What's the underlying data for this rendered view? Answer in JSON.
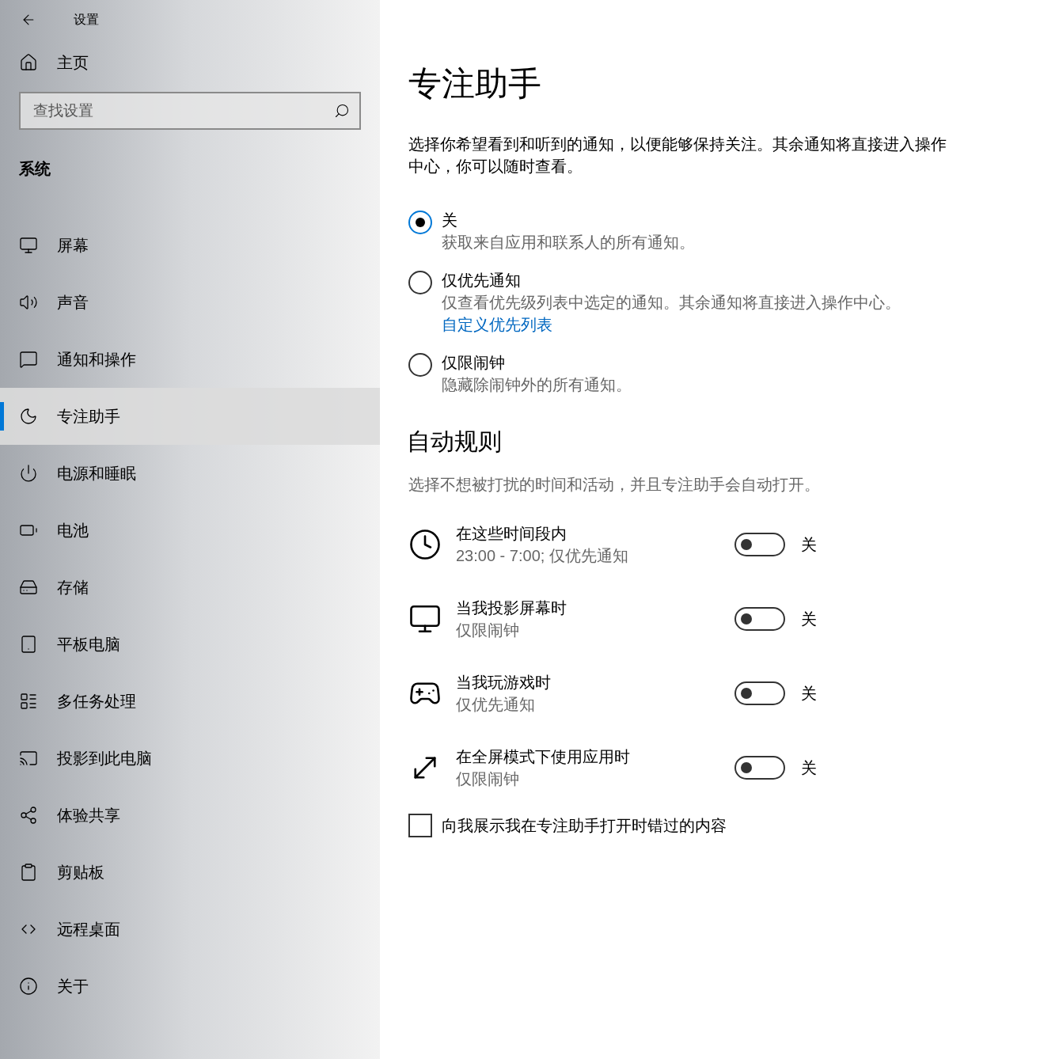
{
  "window": {
    "title": "设置"
  },
  "sidebar": {
    "home": "主页",
    "search": {
      "placeholder": "查找设置"
    },
    "section": "系统",
    "items": [
      {
        "label": "屏幕",
        "kind": "monitor",
        "selected": false
      },
      {
        "label": "声音",
        "kind": "speaker",
        "selected": false
      },
      {
        "label": "通知和操作",
        "kind": "message",
        "selected": false
      },
      {
        "label": "专注助手",
        "kind": "moon",
        "selected": true
      },
      {
        "label": "电源和睡眠",
        "kind": "power",
        "selected": false
      },
      {
        "label": "电池",
        "kind": "battery",
        "selected": false
      },
      {
        "label": "存储",
        "kind": "drive",
        "selected": false
      },
      {
        "label": "平板电脑",
        "kind": "tablet",
        "selected": false
      },
      {
        "label": "多任务处理",
        "kind": "multitask",
        "selected": false
      },
      {
        "label": "投影到此电脑",
        "kind": "project",
        "selected": false
      },
      {
        "label": "体验共享",
        "kind": "share",
        "selected": false
      },
      {
        "label": "剪贴板",
        "kind": "clipboard",
        "selected": false
      },
      {
        "label": "远程桌面",
        "kind": "remote",
        "selected": false
      },
      {
        "label": "关于",
        "kind": "info",
        "selected": false
      }
    ]
  },
  "main": {
    "title": "专注助手",
    "description": "选择你希望看到和听到的通知，以便能够保持关注。其余通知将直接进入操作中心，你可以随时查看。",
    "options": [
      {
        "title": "关",
        "description": "获取来自应用和联系人的所有通知。",
        "selected": true
      },
      {
        "title": "仅优先通知",
        "description": "仅查看优先级列表中选定的通知。其余通知将直接进入操作中心。",
        "link": "自定义优先列表",
        "selected": false
      },
      {
        "title": "仅限闹钟",
        "description": "隐藏除闹钟外的所有通知。",
        "selected": false
      }
    ],
    "rules_heading": "自动规则",
    "rules_description": "选择不想被打扰的时间和活动，并且专注助手会自动打开。",
    "rules": [
      {
        "kind": "clock",
        "title": "在这些时间段内",
        "detail": "23:00 - 7:00; 仅优先通知",
        "on": false,
        "state": "关"
      },
      {
        "kind": "display",
        "title": "当我投影屏幕时",
        "detail": "仅限闹钟",
        "on": false,
        "state": "关"
      },
      {
        "kind": "game",
        "title": "当我玩游戏时",
        "detail": "仅优先通知",
        "on": false,
        "state": "关"
      },
      {
        "kind": "fullscreen",
        "title": "在全屏模式下使用应用时",
        "detail": "仅限闹钟",
        "on": false,
        "state": "关"
      }
    ],
    "summary_checkbox": {
      "label": "向我展示我在专注助手打开时错过的内容",
      "checked": false
    }
  }
}
